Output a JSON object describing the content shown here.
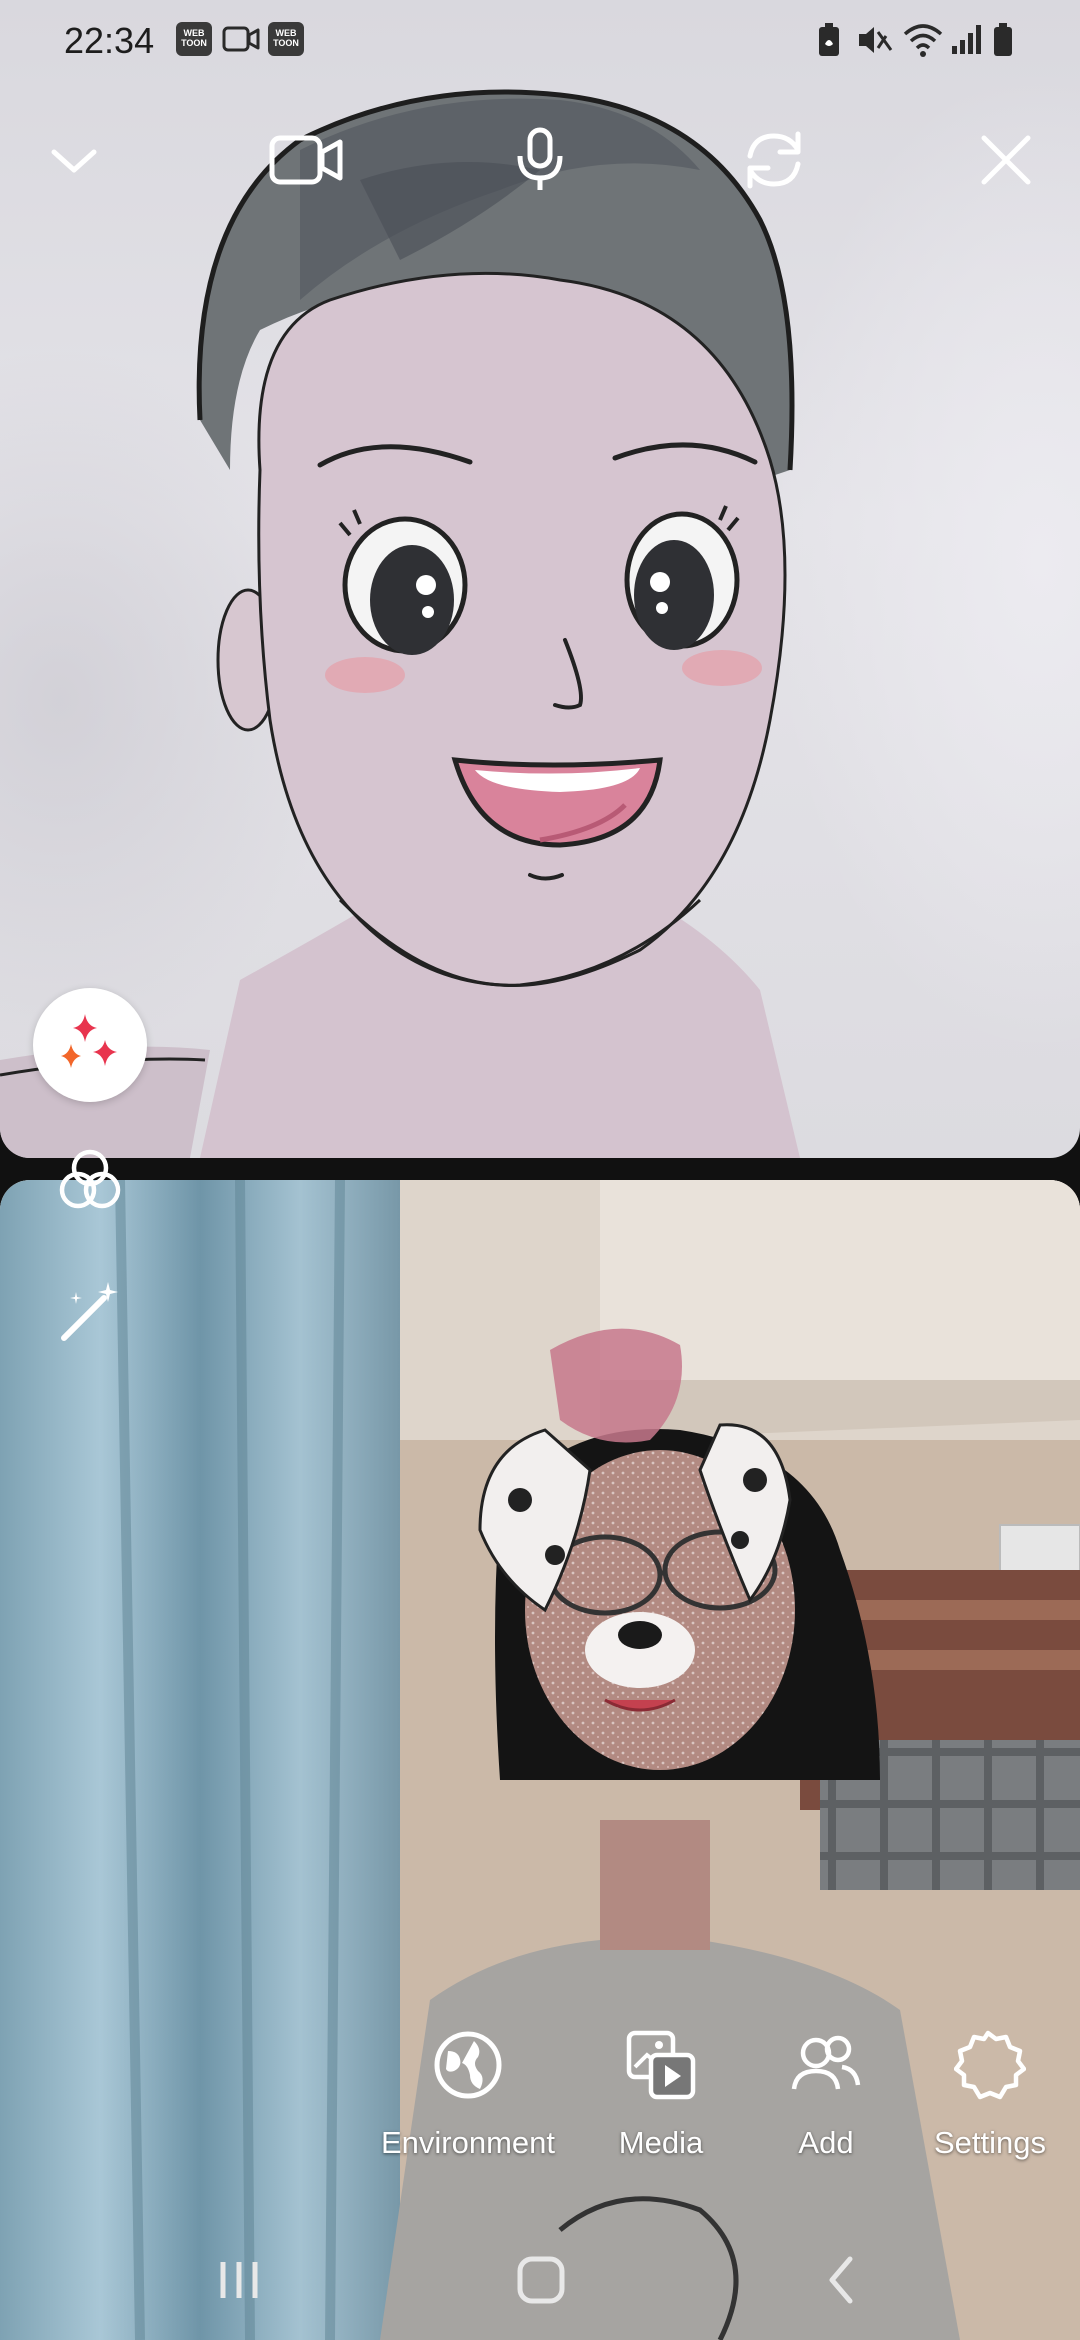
{
  "status_bar": {
    "time": "22:34",
    "badge_1": "WEB TOON",
    "badge_2": "WEB TOON",
    "icons": [
      "webtoon-icon",
      "video-icon",
      "webtoon-icon",
      "battery-saver-icon",
      "mute-icon",
      "wifi-icon",
      "signal-icon",
      "battery-icon"
    ]
  },
  "call_controls": {
    "minimize": "chevron-down-icon",
    "camera": "video-camera-icon",
    "microphone": "microphone-icon",
    "switch_camera": "camera-switch-icon",
    "end": "close-icon"
  },
  "side_controls": {
    "effects": "sparkles-icon",
    "filters": "filter-circles-icon",
    "beauty": "magic-wand-icon"
  },
  "actions": [
    {
      "label": "Environment",
      "icon": "globe-icon"
    },
    {
      "label": "Media",
      "icon": "media-icon"
    },
    {
      "label": "Add",
      "icon": "add-people-icon"
    },
    {
      "label": "Settings",
      "icon": "settings-icon"
    }
  ],
  "nav_bar": {
    "recents": "recents-icon",
    "home": "home-icon",
    "back": "back-icon"
  },
  "colors": {
    "fab_bg": "#ffffff",
    "sparkle_red": "#e8344e",
    "sparkle_orange": "#f2662a",
    "icon_on_video": "#ffffff"
  }
}
